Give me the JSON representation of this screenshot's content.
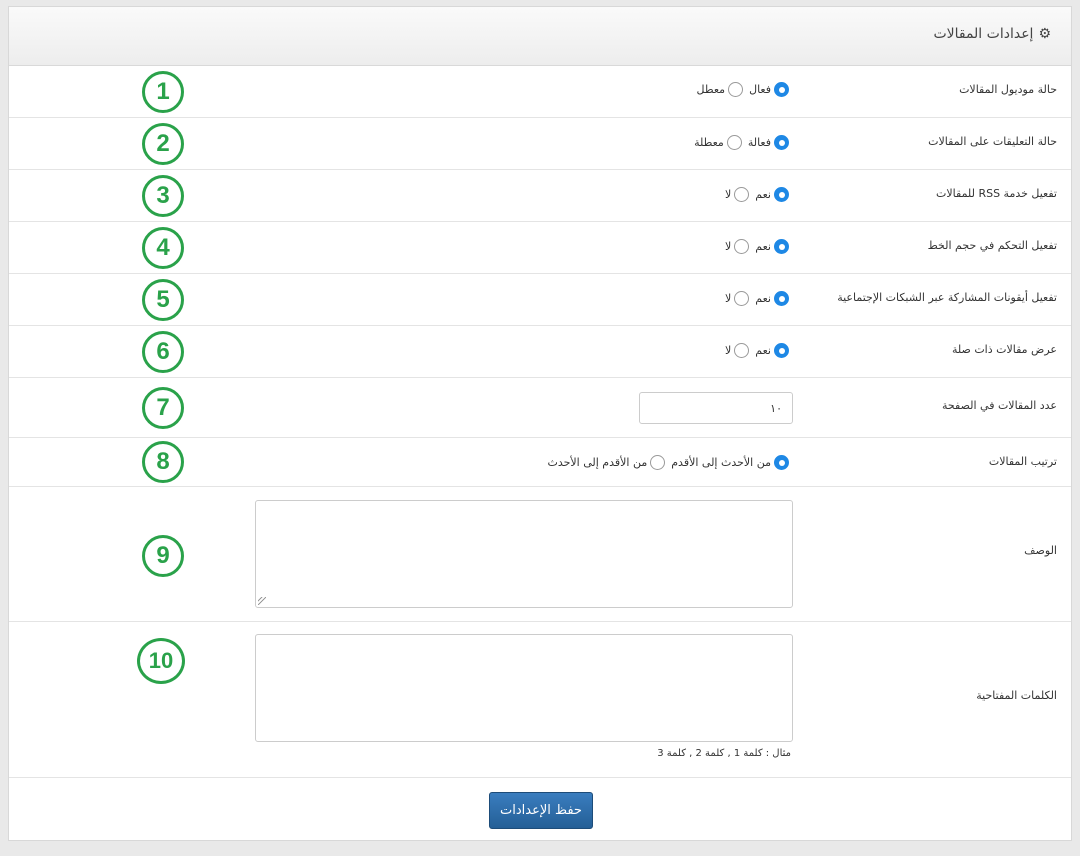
{
  "header": {
    "title": "إعدادات المقالات",
    "icon": "gear-icon"
  },
  "rows": [
    {
      "label": "حالة موديول المقالات",
      "options": [
        "فعال",
        "معطل"
      ],
      "selected": 0
    },
    {
      "label": "حالة التعليقات على المقالات",
      "options": [
        "فعالة",
        "معطلة"
      ],
      "selected": 0
    },
    {
      "label": "تفعيل خدمة RSS للمقالات",
      "options": [
        "نعم",
        "لا"
      ],
      "selected": 0
    },
    {
      "label": "تفعيل التحكم في حجم الخط",
      "options": [
        "نعم",
        "لا"
      ],
      "selected": 0
    },
    {
      "label": "تفعيل أيقونات المشاركة عبر الشبكات الإجتماعية",
      "options": [
        "نعم",
        "لا"
      ],
      "selected": 0
    },
    {
      "label": "عرض مقالات ذات صلة",
      "options": [
        "نعم",
        "لا"
      ],
      "selected": 0
    },
    {
      "label": "عدد المقالات في الصفحة",
      "value": "١٠"
    },
    {
      "label": "ترتيب المقالات",
      "options": [
        "من الأحدث إلى الأقدم",
        "من الأقدم إلى الأحدث"
      ],
      "selected": 0
    },
    {
      "label": "الوصف",
      "value": ""
    },
    {
      "label": "الكلمات المفتاحية",
      "value": "",
      "hint": "مثال : كلمة 1 , كلمة 2 , كلمة 3"
    }
  ],
  "badges": [
    "1",
    "2",
    "3",
    "4",
    "5",
    "6",
    "7",
    "8",
    "9",
    "10"
  ],
  "footer": {
    "save_label": "حفظ الإعدادات"
  },
  "colors": {
    "accent": "#1e88e5",
    "badge": "#2aa24a",
    "button": "#2b6aa5"
  }
}
